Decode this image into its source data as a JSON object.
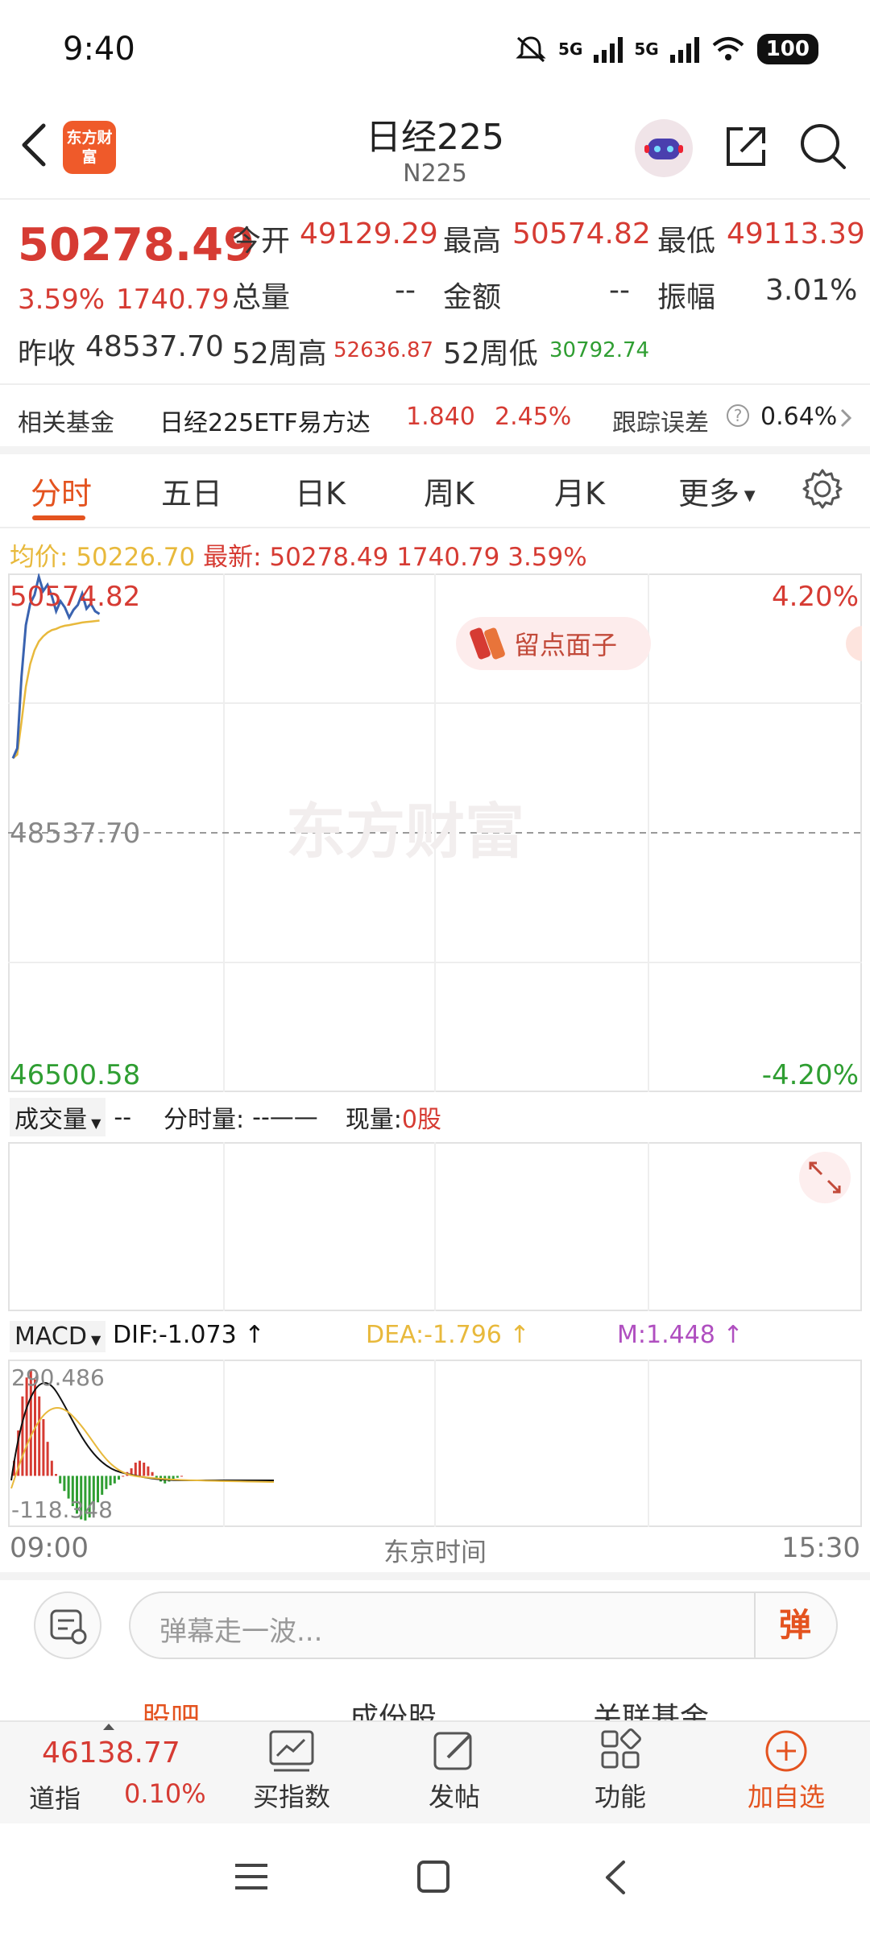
{
  "status_bar": {
    "time": "9:40",
    "network_1": "5G",
    "network_2": "5G",
    "battery": "100",
    "icons": [
      "mute-icon",
      "signal-icon",
      "wifi-icon",
      "battery-icon"
    ]
  },
  "header": {
    "logo_text": "东方财富",
    "title": "日经225",
    "subtitle": "N225"
  },
  "quote": {
    "price": "50278.49",
    "change_pct": "3.59%",
    "change_amt": "1740.79",
    "open_label": "今开",
    "open": "49129.29",
    "high_label": "最高",
    "high": "50574.82",
    "low_label": "最低",
    "low": "49113.39",
    "volume_label": "总量",
    "volume": "--",
    "amount_label": "金额",
    "amount": "--",
    "amplitude_label": "振幅",
    "amplitude": "3.01%",
    "prev_close_label": "昨收",
    "prev_close": "48537.70",
    "wk52_high_label": "52周高",
    "wk52_high": "52636.87",
    "wk52_low_label": "52周低",
    "wk52_low": "30792.74"
  },
  "fund_row": {
    "label": "相关基金",
    "fund_name": "日经225ETF易方达",
    "fund_price": "1.840",
    "fund_pct": "2.45%",
    "tracking_label": "跟踪误差",
    "tracking_value": "0.64%"
  },
  "tabs": [
    "分时",
    "五日",
    "日K",
    "周K",
    "月K",
    "更多"
  ],
  "info_line": {
    "avg_label": "均价:",
    "avg": "50226.70",
    "latest_label": "最新:",
    "latest": "50278.49",
    "change": "1740.79",
    "pct": "3.59%"
  },
  "chart_data": {
    "type": "line",
    "x_axis_labels": [
      "09:00",
      "东京时间",
      "15:30"
    ],
    "y_top_label": "50574.82",
    "y_mid_label": "48537.70",
    "y_bottom_label": "46500.58",
    "pct_top_label": "4.20%",
    "pct_bottom_label": "-4.20%",
    "ylim": [
      46500.58,
      50574.82
    ],
    "watermark": "东方财富",
    "badge": "留点面子",
    "series": [
      {
        "name": "price",
        "color": "#3a63b0",
        "x": [
          "09:00",
          "09:02",
          "09:04",
          "09:06",
          "09:08",
          "09:10",
          "09:12",
          "09:14",
          "09:16",
          "09:18",
          "09:20",
          "09:22",
          "09:24",
          "09:26",
          "09:28",
          "09:30",
          "09:32",
          "09:34",
          "09:36",
          "09:38",
          "09:40"
        ],
        "values": [
          49130,
          49210,
          49780,
          50190,
          50360,
          50430,
          50574,
          50460,
          50510,
          50420,
          50300,
          50380,
          50330,
          50250,
          50310,
          50350,
          50440,
          50320,
          50360,
          50300,
          50278
        ]
      },
      {
        "name": "avg",
        "color": "#e8b93c",
        "x": [
          "09:00",
          "09:02",
          "09:04",
          "09:06",
          "09:08",
          "09:10",
          "09:12",
          "09:14",
          "09:16",
          "09:18",
          "09:20",
          "09:22",
          "09:24",
          "09:26",
          "09:28",
          "09:30",
          "09:32",
          "09:34",
          "09:36",
          "09:38",
          "09:40"
        ],
        "values": [
          49130,
          49160,
          49420,
          49700,
          49880,
          49990,
          50060,
          50100,
          50130,
          50150,
          50160,
          50175,
          50185,
          50190,
          50197,
          50203,
          50210,
          50214,
          50218,
          50222,
          50226
        ]
      }
    ],
    "grid": true
  },
  "volume_panel": {
    "selector": "成交量",
    "value": "--",
    "minute_vol_label": "分时量:",
    "minute_vol": "--——",
    "current_label": "现量:",
    "current": "0股"
  },
  "macd": {
    "selector": "MACD",
    "dif_label": "DIF:",
    "dif": "-1.073",
    "dea_label": "DEA:",
    "dea": "-1.796",
    "m_label": "M:",
    "m": "1.448",
    "top_label": "290.486",
    "bottom_label": "-118.348",
    "colors": {
      "dif": "#111111",
      "dea": "#e8b93c",
      "m": "#b04fc0",
      "up": "#d63b33",
      "down": "#2f9e32"
    },
    "hist": [
      40,
      120,
      210,
      260,
      280,
      255,
      210,
      150,
      90,
      40,
      5,
      -20,
      -40,
      -60,
      -80,
      -100,
      -115,
      -118,
      -110,
      -90,
      -70,
      -50,
      -35,
      -25,
      -20,
      -10,
      0,
      10,
      20,
      35,
      40,
      35,
      25,
      10,
      -5,
      -15,
      -20,
      -15,
      -10,
      -5,
      0
    ]
  },
  "danmaku": {
    "placeholder": "弹幕走一波...",
    "send": "弹"
  },
  "subtabs": [
    "股吧",
    "成份股",
    "关联基金"
  ],
  "bottom_bar": {
    "ticker_value": "46138.77",
    "ticker_name": "道指",
    "ticker_pct": "0.10%",
    "buy_index": "买指数",
    "post": "发帖",
    "functions": "功能",
    "add_watch": "加自选"
  }
}
